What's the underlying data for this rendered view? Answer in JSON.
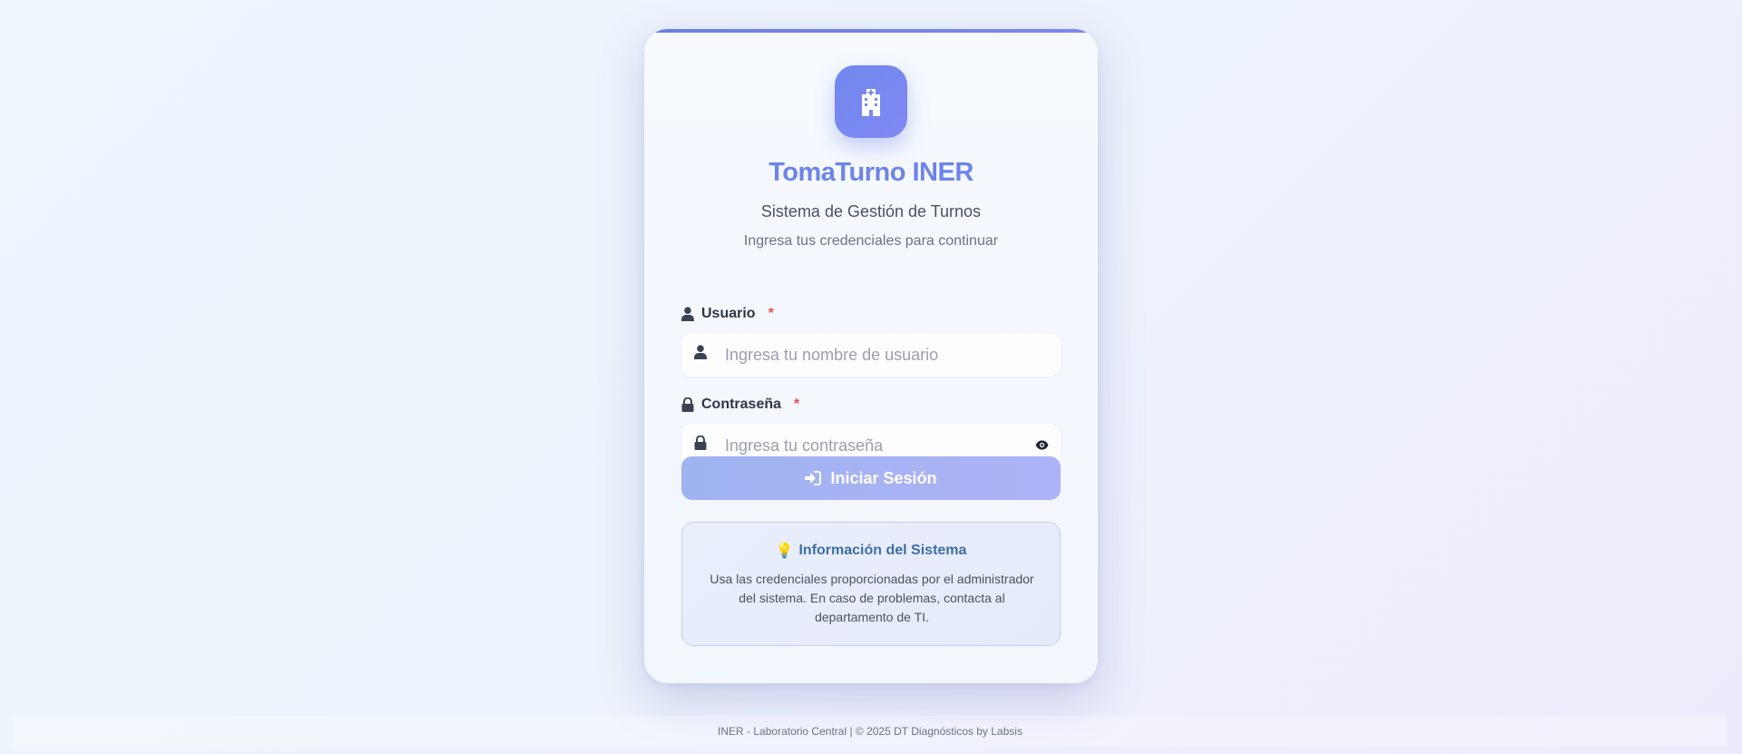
{
  "app": {
    "title": "TomaTurno INER",
    "subtitle": "Sistema de Gestión de Turnos",
    "hint": "Ingresa tus credenciales para continuar",
    "logo_icon": "hospital-icon",
    "accent_color": "#6c84ea"
  },
  "form": {
    "username": {
      "label": "Usuario",
      "required_mark": "*",
      "placeholder": "Ingresa tu nombre de usuario",
      "value": "",
      "icon": "user-icon"
    },
    "password": {
      "label": "Contraseña",
      "required_mark": "*",
      "placeholder": "Ingresa tu contraseña",
      "value": "",
      "icon": "lock-icon",
      "toggle_icon": "eye-icon"
    },
    "submit": {
      "label": "Iniciar Sesión",
      "icon": "sign-in-icon"
    }
  },
  "info": {
    "emoji": "💡",
    "title": "Información del Sistema",
    "text": "Usa las credenciales proporcionadas por el administrador del sistema. En caso de problemas, contacta al departamento de TI."
  },
  "footer": {
    "text": "INER - Laboratorio Central | © 2025 DT Diagnósticos by Labsis"
  }
}
